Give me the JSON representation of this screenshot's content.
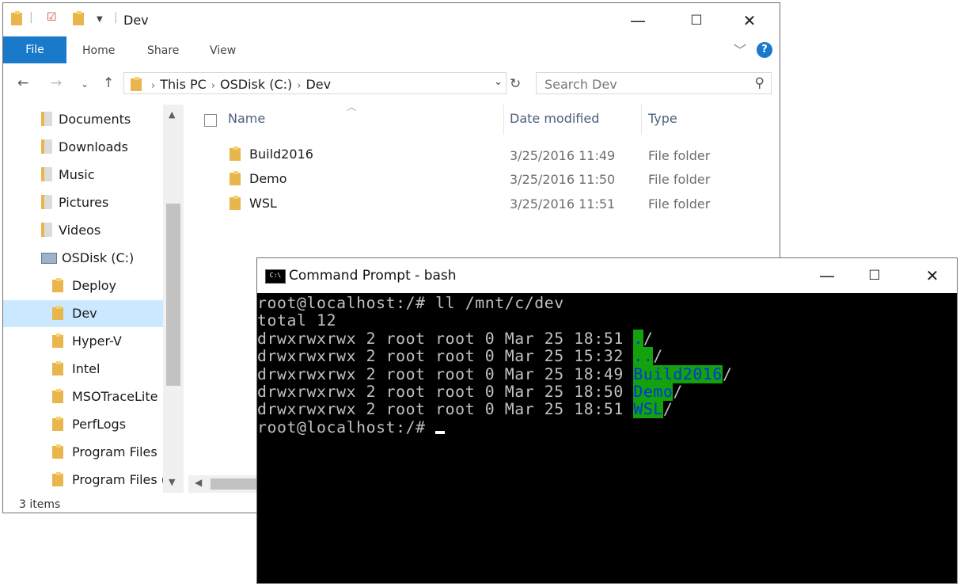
{
  "explorer": {
    "title": "Dev",
    "ribbon_tabs": [
      "File",
      "Home",
      "Share",
      "View"
    ],
    "help_label": "?",
    "breadcrumb": [
      "This PC",
      "OSDisk (C:)",
      "Dev"
    ],
    "search_placeholder": "Search Dev",
    "sidebar": [
      {
        "label": "Documents",
        "icon": "documents-icon"
      },
      {
        "label": "Downloads",
        "icon": "downloads-icon"
      },
      {
        "label": "Music",
        "icon": "music-icon"
      },
      {
        "label": "Pictures",
        "icon": "pictures-icon"
      },
      {
        "label": "Videos",
        "icon": "videos-icon"
      },
      {
        "label": "OSDisk (C:)",
        "icon": "drive-icon"
      },
      {
        "label": "Deploy",
        "icon": "folder-icon"
      },
      {
        "label": "Dev",
        "icon": "folder-icon",
        "selected": true
      },
      {
        "label": "Hyper-V",
        "icon": "folder-icon"
      },
      {
        "label": "Intel",
        "icon": "folder-icon"
      },
      {
        "label": "MSOTraceLite",
        "icon": "folder-icon"
      },
      {
        "label": "PerfLogs",
        "icon": "folder-icon"
      },
      {
        "label": "Program Files",
        "icon": "folder-icon"
      },
      {
        "label": "Program Files (:",
        "icon": "folder-icon"
      }
    ],
    "columns": [
      "Name",
      "Date modified",
      "Type"
    ],
    "files": [
      {
        "name": "Build2016",
        "date": "3/25/2016 11:49",
        "type": "File folder"
      },
      {
        "name": "Demo",
        "date": "3/25/2016 11:50",
        "type": "File folder"
      },
      {
        "name": "WSL",
        "date": "3/25/2016 11:51",
        "type": "File folder"
      }
    ],
    "status": "3 items",
    "accent_color": "#1979ca",
    "selection_color": "#cce8ff"
  },
  "console": {
    "title": "Command Prompt - bash",
    "icon_label": "C:\\",
    "prompt": "root@localhost:/# ",
    "command": "ll /mnt/c/dev",
    "total": "total 12",
    "entries": [
      {
        "meta": "drwxrwxrwx 2 root root 0 Mar 25 18:51 ",
        "name": ".",
        "suffix": "/"
      },
      {
        "meta": "drwxrwxrwx 2 root root 0 Mar 25 15:32 ",
        "name": "..",
        "suffix": "/"
      },
      {
        "meta": "drwxrwxrwx 2 root root 0 Mar 25 18:49 ",
        "name": "Build2016",
        "suffix": "/"
      },
      {
        "meta": "drwxrwxrwx 2 root root 0 Mar 25 18:50 ",
        "name": "Demo",
        "suffix": "/"
      },
      {
        "meta": "drwxrwxrwx 2 root root 0 Mar 25 18:51 ",
        "name": "WSL",
        "suffix": "/"
      }
    ],
    "highlight_bg": "#13a10e",
    "highlight_fg": "#0037da"
  }
}
